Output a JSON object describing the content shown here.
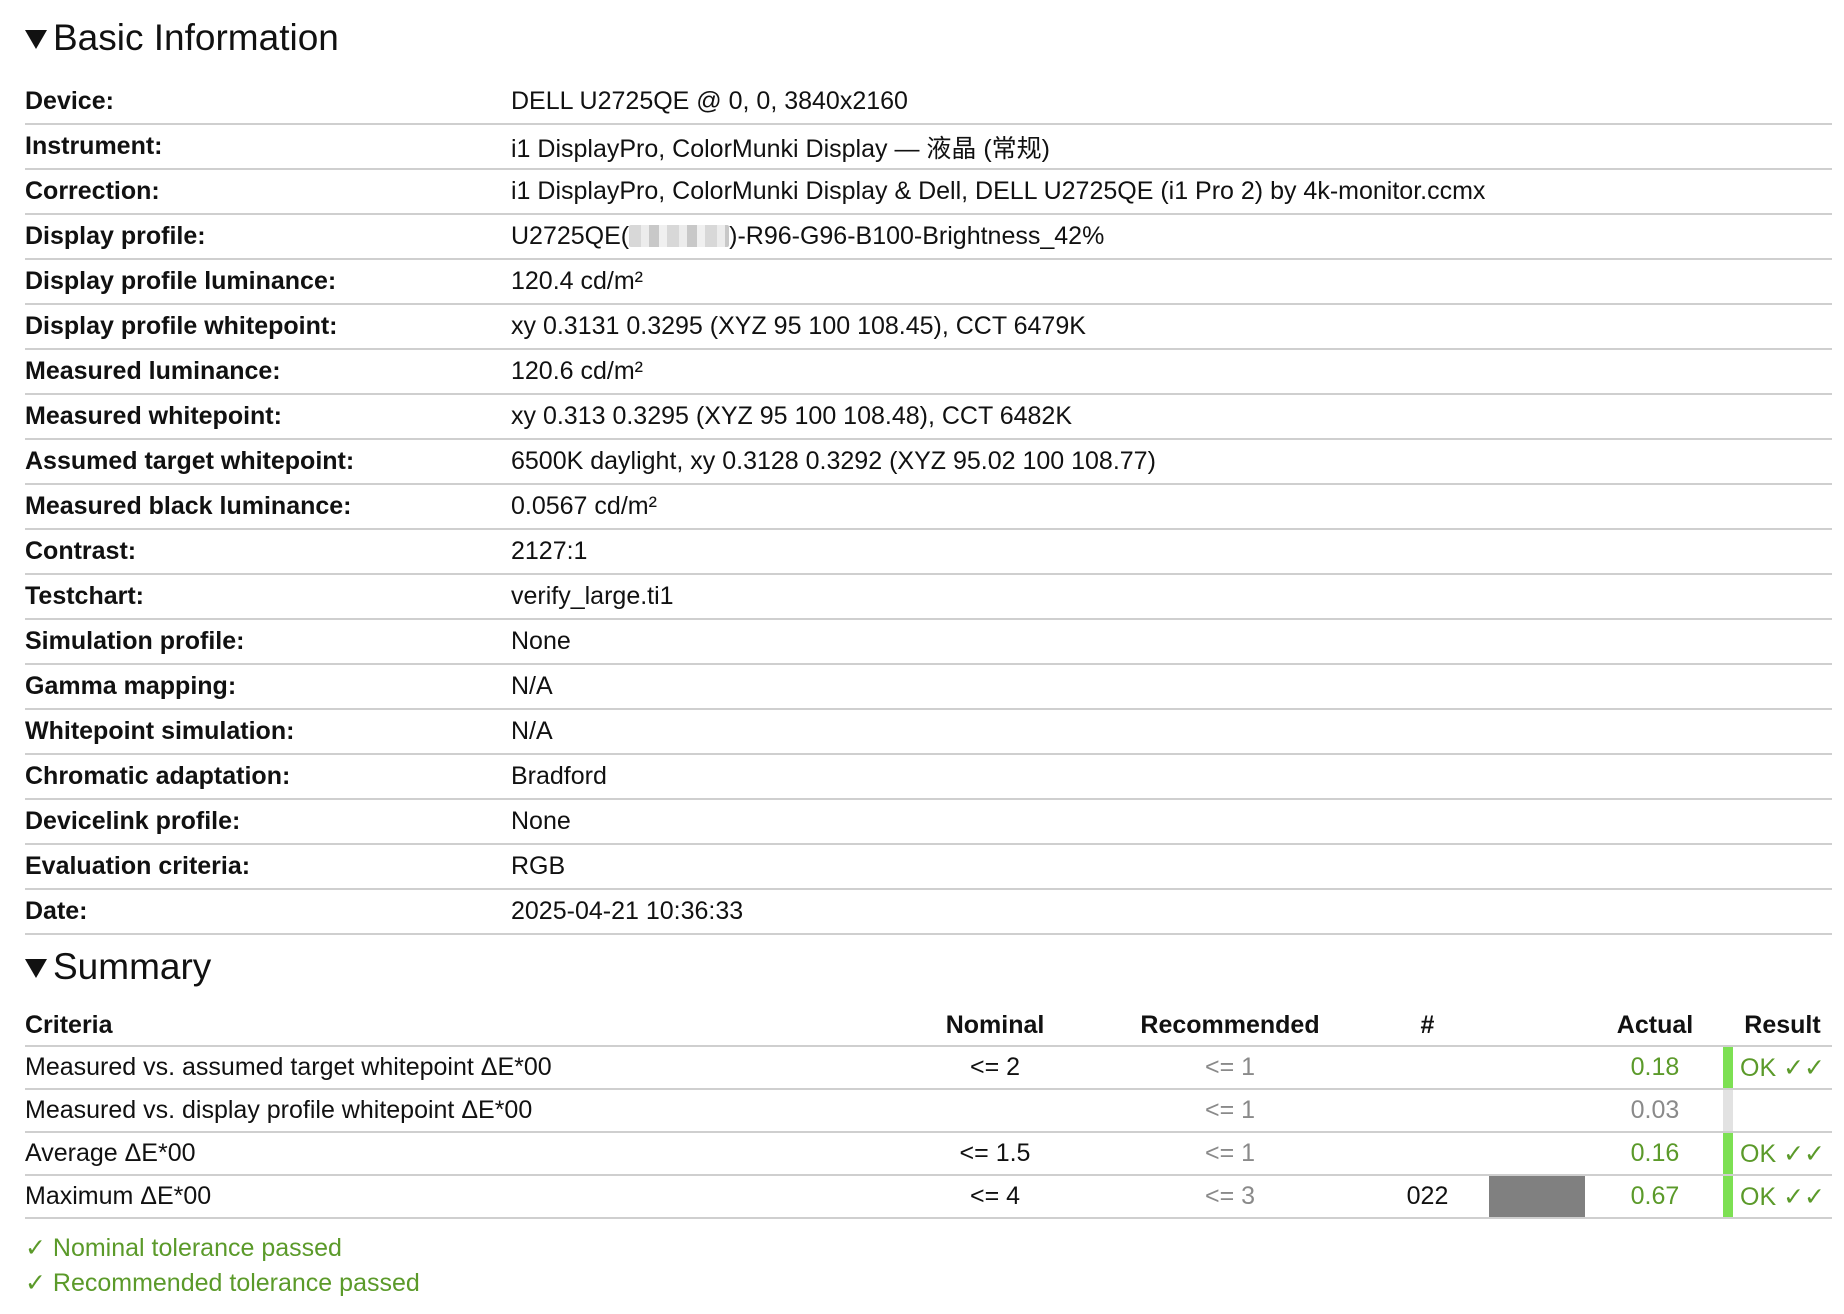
{
  "basic": {
    "title": "Basic Information",
    "rows": [
      {
        "label": "Device:",
        "value": "DELL U2725QE @ 0, 0, 3840x2160"
      },
      {
        "label": "Instrument:",
        "value": "i1 DisplayPro, ColorMunki Display — 液晶 (常规)"
      },
      {
        "label": "Correction:",
        "value": "i1 DisplayPro, ColorMunki Display & Dell, DELL U2725QE (i1 Pro 2) by 4k-monitor.ccmx"
      },
      {
        "label": "Display profile:",
        "value_prefix": "U2725QE(",
        "value_suffix": ")-R96-G96-B100-Brightness_42%"
      },
      {
        "label": "Display profile luminance:",
        "value": "120.4 cd/m²"
      },
      {
        "label": "Display profile whitepoint:",
        "value": "xy 0.3131 0.3295 (XYZ 95 100 108.45), CCT 6479K"
      },
      {
        "label": "Measured luminance:",
        "value": "120.6 cd/m²"
      },
      {
        "label": "Measured whitepoint:",
        "value": "xy 0.313 0.3295 (XYZ 95 100 108.48), CCT 6482K"
      },
      {
        "label": "Assumed target whitepoint:",
        "value": "6500K daylight, xy 0.3128 0.3292 (XYZ 95.02 100 108.77)"
      },
      {
        "label": "Measured black luminance:",
        "value": "0.0567 cd/m²"
      },
      {
        "label": "Contrast:",
        "value": "2127:1"
      },
      {
        "label": "Testchart:",
        "value": "verify_large.ti1"
      },
      {
        "label": "Simulation profile:",
        "value": "None"
      },
      {
        "label": "Gamma mapping:",
        "value": "N/A"
      },
      {
        "label": "Whitepoint simulation:",
        "value": "N/A"
      },
      {
        "label": "Chromatic adaptation:",
        "value": "Bradford"
      },
      {
        "label": "Devicelink profile:",
        "value": "None"
      },
      {
        "label": "Evaluation criteria:",
        "value": "RGB"
      },
      {
        "label": "Date:",
        "value": "2025-04-21 10:36:33"
      }
    ]
  },
  "summary": {
    "title": "Summary",
    "headers": {
      "criteria": "Criteria",
      "nominal": "Nominal",
      "recommended": "Recommended",
      "num": "#",
      "actual": "Actual",
      "result": "Result"
    },
    "rows": [
      {
        "criteria": "Measured vs. assumed target whitepoint ΔE*00",
        "nominal": "<= 2",
        "recommended": "<= 1",
        "num": "",
        "actual": "0.18",
        "actual_status": "pass",
        "result": "OK ✓✓"
      },
      {
        "criteria": "Measured vs. display profile whitepoint ΔE*00",
        "nominal": "",
        "recommended": "<= 1",
        "num": "",
        "actual": "0.03",
        "actual_status": "none",
        "result": ""
      },
      {
        "criteria": "Average ΔE*00",
        "nominal": "<= 1.5",
        "recommended": "<= 1",
        "num": "",
        "actual": "0.16",
        "actual_status": "pass",
        "result": "OK ✓✓"
      },
      {
        "criteria": "Maximum ΔE*00",
        "nominal": "<= 4",
        "recommended": "<= 3",
        "num": "022",
        "swatch_color": "#808080",
        "actual": "0.67",
        "actual_status": "pass",
        "result": "OK ✓✓"
      }
    ],
    "status_lines": [
      "✓ Nominal tolerance passed",
      "✓ Recommended tolerance passed"
    ]
  },
  "colors": {
    "pass_green": "#5b9a2a",
    "bar_green": "#7de053",
    "muted_gray": "#8a8a8a"
  }
}
